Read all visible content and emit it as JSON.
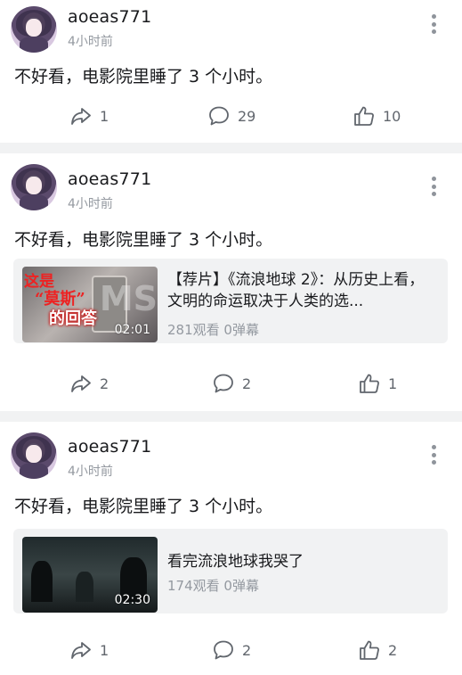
{
  "colors": {
    "text": "#18191c",
    "muted": "#9499a0",
    "action": "#61666d",
    "card_bg": "#f1f2f3"
  },
  "posts": [
    {
      "username": "aoeas771",
      "time": "4小时前",
      "text": "不好看，电影院里睡了 3 个小时。",
      "actions": {
        "share": "1",
        "comment": "29",
        "like": "10"
      }
    },
    {
      "username": "aoeas771",
      "time": "4小时前",
      "text": "不好看，电影院里睡了 3 个小时。",
      "card": {
        "thumb_text_1": "这是",
        "thumb_text_2": "“莫斯”",
        "thumb_text_3": "的回答",
        "duration": "02:01",
        "title": "【荐片】《流浪地球 2》：从历史上看，文明的命运取决于人类的选...",
        "stats": "281观看 0弹幕"
      },
      "actions": {
        "share": "2",
        "comment": "2",
        "like": "1"
      }
    },
    {
      "username": "aoeas771",
      "time": "4小时前",
      "text": "不好看，电影院里睡了 3 个小时。",
      "card": {
        "duration": "02:30",
        "title": "看完流浪地球我哭了",
        "stats": "174观看 0弹幕"
      },
      "actions": {
        "share": "1",
        "comment": "2",
        "like": "2"
      }
    }
  ],
  "icons": [
    "avatar",
    "more-icon",
    "share-icon",
    "comment-icon",
    "like-icon"
  ]
}
